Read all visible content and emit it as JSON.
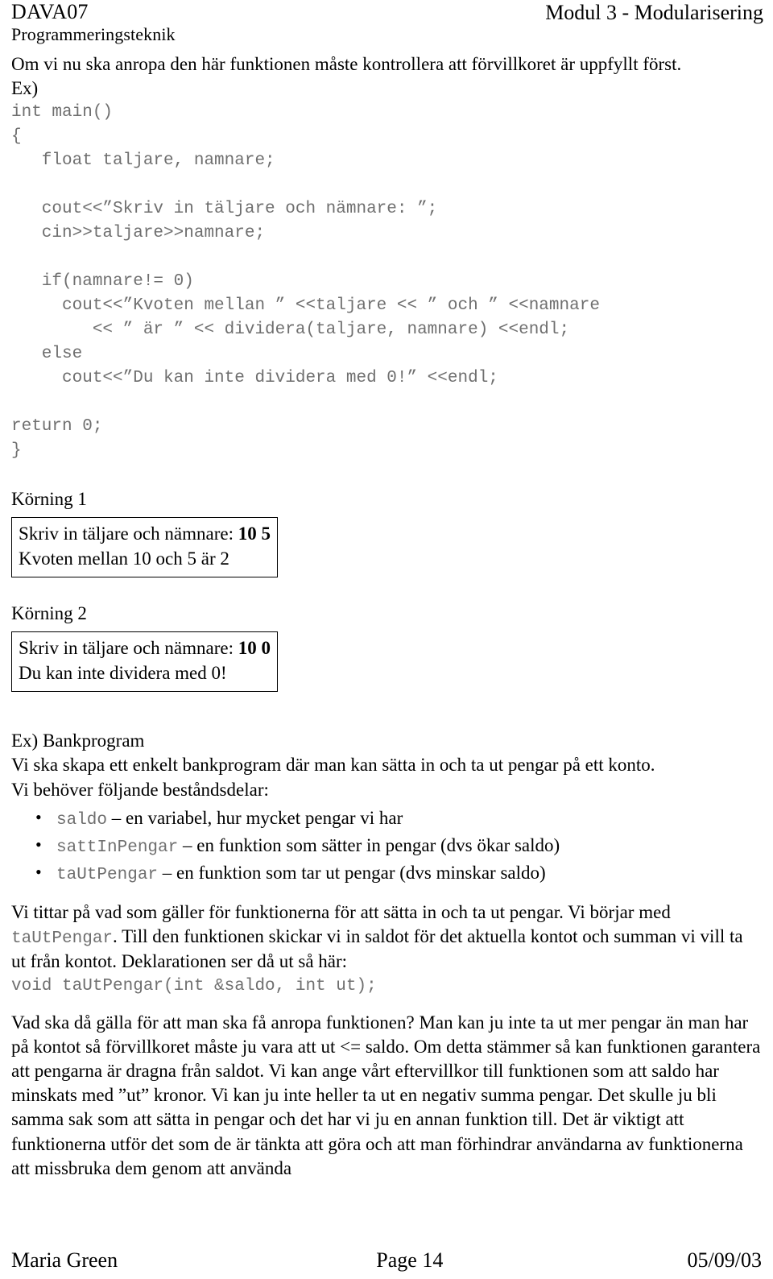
{
  "header": {
    "course_code": "DAVA07",
    "subject": "Programmeringsteknik",
    "module": "Modul 3 - Modularisering"
  },
  "intro": {
    "paragraph": "Om vi nu ska anropa den här funktionen måste kontrollera att förvillkoret är uppfyllt först.",
    "example_label": "Ex)"
  },
  "code_block": {
    "text": "int main()\n{\n   float taljare, namnare;\n\n   cout<<”Skriv in täljare och nämnare: ”;\n   cin>>taljare>>namnare;\n\n   if(namnare!= 0)\n     cout<<”Kvoten mellan ” <<taljare << ” och ” <<namnare\n        << ” är ” << dividera(taljare, namnare) <<endl;\n   else\n     cout<<”Du kan inte dividera med 0!” <<endl;\n\nreturn 0;\n}"
  },
  "run1": {
    "title": "Körning 1",
    "line1_prompt": "Skriv in täljare och nämnare: ",
    "line1_input": "10 5",
    "line2": "Kvoten mellan 10 och 5 är 2"
  },
  "run2": {
    "title": "Körning 2",
    "line1_prompt": "Skriv in täljare och nämnare: ",
    "line1_input": "10 0",
    "line2": "Du kan inte dividera med 0!"
  },
  "bank": {
    "heading": "Ex) Bankprogram",
    "intro": "Vi ska skapa ett enkelt bankprogram där man kan sätta in och ta ut pengar på ett konto.",
    "needs_label": "Vi behöver följande beståndsdelar:",
    "bullets": [
      {
        "code": "saldo",
        "desc": " – en variabel, hur mycket pengar vi har"
      },
      {
        "code": "sattInPengar",
        "desc": " – en funktion som sätter in pengar (dvs ökar saldo)"
      },
      {
        "code": "taUtPengar",
        "desc": " – en funktion som tar ut pengar (dvs minskar saldo)"
      }
    ],
    "para2_a": "Vi tittar på vad som gäller för funktionerna för att sätta in och ta ut pengar. Vi börjar med ",
    "para2_code": "taUtPengar",
    "para2_b": ". Till den funktionen skickar vi in saldot för det aktuella kontot och summan vi vill ta ut från kontot. Deklarationen ser då ut så här:",
    "declaration": "void taUtPengar(int &saldo, int ut);",
    "para3": "Vad ska då gälla för att man ska få anropa funktionen? Man kan ju inte ta ut mer pengar än man har på kontot så förvillkoret måste ju vara att ut <= saldo. Om detta stämmer så kan funktionen garantera att pengarna är dragna från saldot. Vi kan ange vårt eftervillkor till funktionen som att saldo har minskats med ”ut” kronor. Vi kan ju inte heller ta ut en negativ summa pengar. Det skulle ju bli samma sak som att sätta in pengar och det har vi ju en annan funktion till. Det är viktigt att funktionerna utför det som de är tänkta att göra och att man förhindrar användarna av funktionerna att missbruka dem genom att använda"
  },
  "footer": {
    "author": "Maria Green",
    "page": "Page 14",
    "date": "05/09/03"
  }
}
